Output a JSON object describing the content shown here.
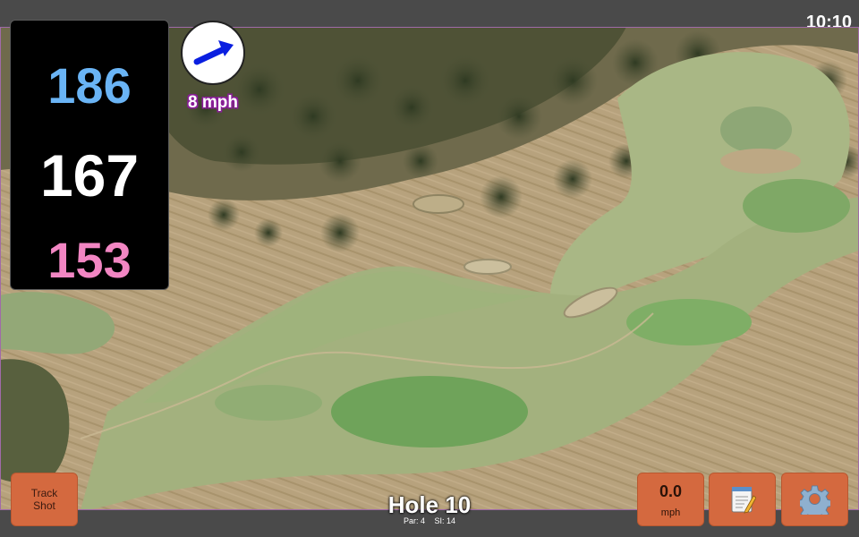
{
  "status": {
    "time": "10:10"
  },
  "distances": {
    "back": "186",
    "middle": "167",
    "front": "153"
  },
  "wind": {
    "speed": "8 mph",
    "direction_icon": "wind-arrow-icon"
  },
  "hole": {
    "title": "Hole 10",
    "par": "Par: 4",
    "stroke_index": "SI: 14"
  },
  "buttons": {
    "track_shot_line1": "Track",
    "track_shot_line2": "Shot",
    "speed_value": "0.0",
    "speed_unit": "mph",
    "notes_icon": "notepad-icon",
    "settings_icon": "gear-icon"
  },
  "colors": {
    "back_distance": "#6ab4f5",
    "middle_distance": "#ffffff",
    "front_distance": "#f286c3",
    "button": "#d4693f",
    "wind_arrow": "#0a1fe0"
  }
}
